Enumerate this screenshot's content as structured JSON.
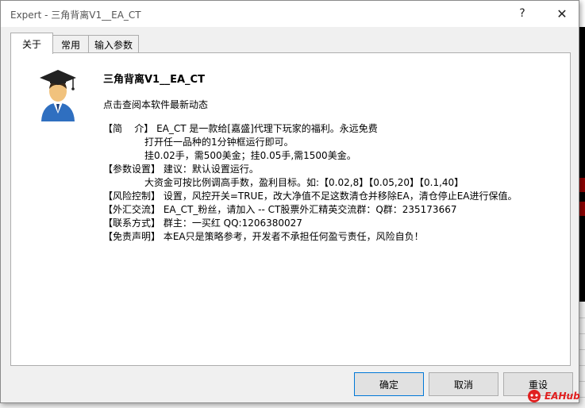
{
  "window": {
    "title": "Expert - 三角背离V1__EA_CT",
    "help_label": "?",
    "close_label": "✕"
  },
  "tabs": [
    {
      "label": "关于",
      "active": true
    },
    {
      "label": "常用",
      "active": false
    },
    {
      "label": "输入参数",
      "active": false
    }
  ],
  "about": {
    "title": "三角背离V1__EA_CT",
    "link": "点击查阅本软件最新动态",
    "lines": [
      "【简    介】 EA_CT 是一款给[嘉盛]代理下玩家的福利。永远免费",
      "打开任一品种的1分钟框运行即可。",
      "挂0.02手，需500美金；挂0.05手,需1500美金。",
      "【参数设置】 建议：默认设置运行。",
      "大资金可按比例调高手数，盈利目标。如:【0.02,8】【0.05,20】【0.1,40】",
      "【风险控制】 设置，风控开关=TRUE，改大净值不足这数清仓并移除EA，清仓停止EA进行保值。",
      "【外汇交流】 EA_CT_粉丝，请加入 -- CT股票外汇精英交流群：Q群：235173667",
      "【联系方式】 群主：一买红 QQ:1206380027",
      "【免责声明】 本EA只是策略参考，开发者不承担任何盈亏责任，风险自负！"
    ]
  },
  "buttons": {
    "ok": "确定",
    "cancel": "取消",
    "reset": "重设"
  },
  "watermark": "EAHub",
  "icons": {
    "avatar": "graduate-user-icon",
    "help": "help-icon",
    "close": "close-icon",
    "watermark_logo": "eahub-logo-icon"
  },
  "colors": {
    "dialog_bg": "#f0f0f0",
    "panel_bg": "#ffffff",
    "accent_border": "#0078d7",
    "watermark": "#e02020"
  }
}
